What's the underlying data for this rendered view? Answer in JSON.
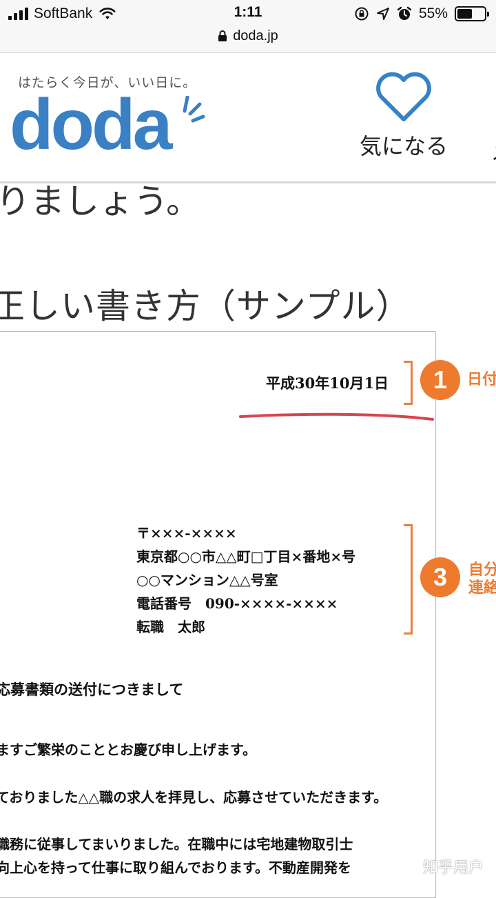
{
  "status_bar": {
    "carrier": "SoftBank",
    "time": "1:11",
    "battery_percent": "55%",
    "battery_level": 0.55,
    "url": "doda.jp"
  },
  "header": {
    "tagline": "はたらく今日が、いい日に。",
    "logo": "doda",
    "favorite_label": "気になる",
    "cut_nav_label": "メ",
    "brand_color": "#3a80c4"
  },
  "article": {
    "heading_fragment": "りましょう。",
    "section_title": "正しい書き方（サンプル）"
  },
  "letter": {
    "date": "平成30年10月1日",
    "address_lines": [
      "〒×××-××××",
      "東京都○○市△△町□丁目×番地×号",
      "○○マンション△△号室",
      "電話番号　090-××××-××××",
      "転職　太郎"
    ],
    "subject": "応募書類の送付につきまして",
    "body_lines": [
      "ますご繁栄のこととお慶び申し上げます。",
      "ておりました△△職の求人を拝見し、応募させていただきます。",
      "職務に従事してまいりました。在職中には宅地建物取引士",
      "向上心を持って仕事に取り組んでおります。不動産開発を"
    ]
  },
  "annotations": {
    "accent_color": "#ee7a2e",
    "items": [
      {
        "number": "1",
        "label": "日付"
      },
      {
        "number": "3",
        "label_lines": [
          "自分",
          "連絡"
        ]
      }
    ]
  },
  "watermark": "知乎用户"
}
